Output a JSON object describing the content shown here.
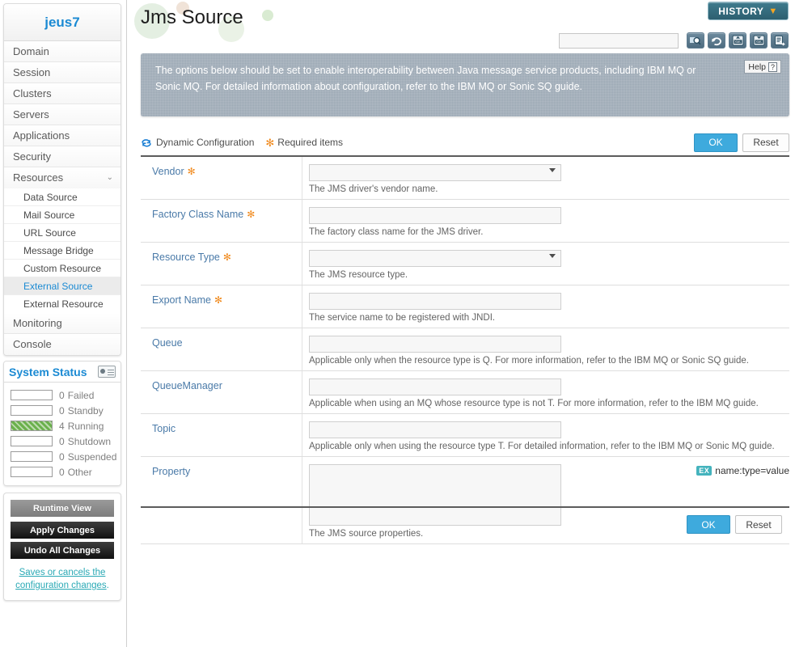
{
  "sidebar": {
    "brand": "jeus7",
    "nav": [
      {
        "label": "Domain",
        "chevron": ""
      },
      {
        "label": "Session",
        "chevron": ""
      },
      {
        "label": "Clusters",
        "chevron": ""
      },
      {
        "label": "Servers",
        "chevron": ""
      },
      {
        "label": "Applications",
        "chevron": ""
      },
      {
        "label": "Security",
        "chevron": ""
      },
      {
        "label": "Resources",
        "chevron": "⌄"
      }
    ],
    "sub_items": [
      {
        "label": "Data Source",
        "active": false
      },
      {
        "label": "Mail Source",
        "active": false
      },
      {
        "label": "URL Source",
        "active": false
      },
      {
        "label": "Message Bridge",
        "active": false
      },
      {
        "label": "Custom Resource",
        "active": false
      },
      {
        "label": "External Source",
        "active": true
      },
      {
        "label": "External Resource",
        "active": false
      }
    ],
    "nav_tail": [
      {
        "label": "Monitoring",
        "chevron": ""
      },
      {
        "label": "Console",
        "chevron": ""
      }
    ],
    "status": {
      "title": "System Status",
      "icon": "laptop-icon",
      "rows": [
        {
          "count": "0",
          "label": "Failed",
          "filled": false
        },
        {
          "count": "0",
          "label": "Standby",
          "filled": false
        },
        {
          "count": "4",
          "label": "Running",
          "filled": true
        },
        {
          "count": "0",
          "label": "Shutdown",
          "filled": false
        },
        {
          "count": "0",
          "label": "Suspended",
          "filled": false
        },
        {
          "count": "0",
          "label": "Other",
          "filled": false
        }
      ]
    },
    "actions": {
      "runtime_view": "Runtime View",
      "apply_changes": "Apply Changes",
      "undo_all_changes": "Undo All Changes",
      "note_link": "Saves or cancels the configuration changes",
      "note_tail": "."
    }
  },
  "header": {
    "title": "Jms Source",
    "history_label": "HISTORY",
    "history_chevron": "▼",
    "search_value": "",
    "search_placeholder": "",
    "toolbar_icons": [
      "search-icon",
      "refresh-icon",
      "xml-import-icon",
      "xml-export-icon",
      "report-export-icon"
    ]
  },
  "banner": {
    "text": "The options below should be set to enable interoperability between Java message service products, including IBM MQ or Sonic MQ. For detailed information about configuration, refer to the IBM MQ or Sonic SQ guide.",
    "help_label": "Help",
    "help_mark": "?"
  },
  "legend": {
    "dynamic_configuration": "Dynamic Configuration",
    "required_items": "Required items",
    "required_marker": "✻",
    "ok_label": "OK",
    "reset_label": "Reset"
  },
  "form": {
    "rows": [
      {
        "label": "Vendor",
        "required": true,
        "control": "select",
        "value": "",
        "hint": "The JMS driver's vendor name."
      },
      {
        "label": "Factory Class Name",
        "required": true,
        "control": "text",
        "value": "",
        "hint": "The factory class name for the JMS driver."
      },
      {
        "label": "Resource Type",
        "required": true,
        "control": "select",
        "value": "",
        "hint": "The JMS resource type."
      },
      {
        "label": "Export Name",
        "required": true,
        "control": "text",
        "value": "",
        "hint": "The service name to be registered with JNDI."
      },
      {
        "label": "Queue",
        "required": false,
        "control": "text",
        "value": "",
        "hint": "Applicable only when the resource type is Q. For more information, refer to the IBM MQ or Sonic SQ guide."
      },
      {
        "label": "QueueManager",
        "required": false,
        "control": "text",
        "value": "",
        "hint": "Applicable when using an MQ whose resource type is not T. For more information, refer to the IBM MQ guide."
      },
      {
        "label": "Topic",
        "required": false,
        "control": "text",
        "value": "",
        "hint": "Applicable only when using the resource type T. For detailed information, refer to the IBM MQ or Sonic MQ guide."
      },
      {
        "label": "Property",
        "required": false,
        "control": "textarea",
        "value": "",
        "hint": "The JMS source properties.",
        "example_badge": "EX",
        "example_text": "name:type=value"
      }
    ]
  },
  "footer": {
    "ok_label": "OK",
    "reset_label": "Reset"
  }
}
